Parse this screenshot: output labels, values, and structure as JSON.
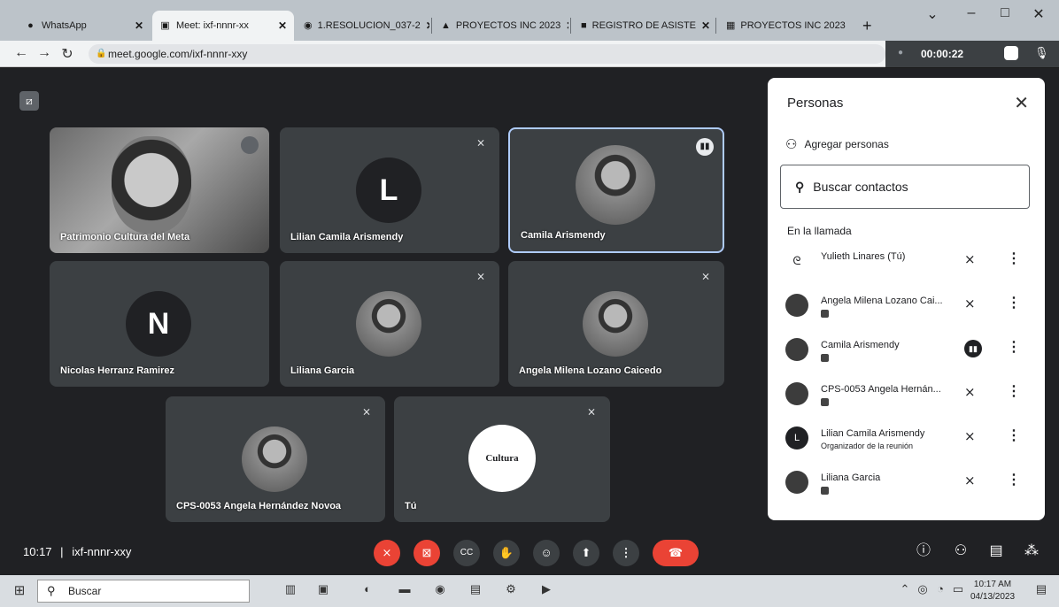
{
  "browser": {
    "tabs": [
      {
        "label": "WhatsApp",
        "icon": "whatsapp-icon"
      },
      {
        "label": "Meet: ixf-nnnr-xx",
        "icon": "meet-icon"
      },
      {
        "label": "1.RESOLUCION_037-2",
        "icon": "chrome-icon"
      },
      {
        "label": "PROYECTOS INC 2023",
        "icon": "drive-icon"
      },
      {
        "label": "REGISTRO DE ASISTE",
        "icon": "forms-icon"
      },
      {
        "label": "PROYECTOS INC 2023",
        "icon": "sheets-icon"
      }
    ],
    "url": "meet.google.com/ixf-nnnr-xxy",
    "call_timer": "00:00:22"
  },
  "meet": {
    "tiles": [
      {
        "name": "Patrimonio Cultura del Meta",
        "type": "video"
      },
      {
        "name": "Lilian Camila Arismendy",
        "type": "initial",
        "initial": "L",
        "color": "#3c4043"
      },
      {
        "name": "Camila Arismendy",
        "type": "photo"
      },
      {
        "name": "Nicolas Herranz Ramirez",
        "type": "initial",
        "initial": "N",
        "color": "#3c4043"
      },
      {
        "name": "Liliana Garcia",
        "type": "photo"
      },
      {
        "name": "Angela Milena Lozano Caicedo",
        "type": "photo"
      },
      {
        "name": "CPS-0053 Angela Hernández Novoa",
        "type": "photo"
      },
      {
        "name": "Tú",
        "type": "logo",
        "logo_text": "Cultura"
      }
    ],
    "meeting_time": "10:17",
    "meeting_code": "ixf-nnnr-xxy"
  },
  "people_panel": {
    "title": "Personas",
    "add_people": "Agregar personas",
    "search_placeholder": "Buscar contactos",
    "section": "En la llamada",
    "participants": [
      {
        "name": "Yulieth Linares (Tú)",
        "role": "",
        "mic": "muted"
      },
      {
        "name": "Angela Milena Lozano Cai...",
        "role": "",
        "mic": "muted"
      },
      {
        "name": "Camila Arismendy",
        "role": "",
        "mic": "speaking"
      },
      {
        "name": "CPS-0053 Angela Hernán...",
        "role": "",
        "mic": "muted"
      },
      {
        "name": "Lilian Camila Arismendy",
        "role": "Organizador de la reunión",
        "mic": "muted"
      },
      {
        "name": "Liliana Garcia",
        "role": "",
        "mic": "muted"
      }
    ]
  },
  "taskbar": {
    "search": "Buscar",
    "time": "10:17 AM",
    "date": "04/13/2023"
  },
  "colors": {
    "meet_bg": "#202124",
    "tile_bg": "#3c4043",
    "hangup": "#ea4335"
  }
}
